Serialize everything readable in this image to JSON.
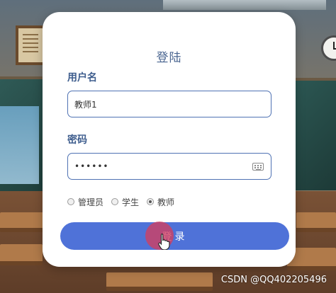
{
  "login": {
    "title": "登陆",
    "username_label": "用户名",
    "username_value": "教师1",
    "password_label": "密码",
    "password_mask": "••••••",
    "roles": [
      {
        "label": "管理员",
        "selected": false
      },
      {
        "label": "学生",
        "selected": false
      },
      {
        "label": "教师",
        "selected": true
      }
    ],
    "login_button": "登录",
    "accent_color": "#4f72d8"
  },
  "watermark": "CSDN @QQ402205496",
  "icons": {
    "password_field": "keyboard-icon",
    "pointer": "hand-cursor-icon"
  }
}
